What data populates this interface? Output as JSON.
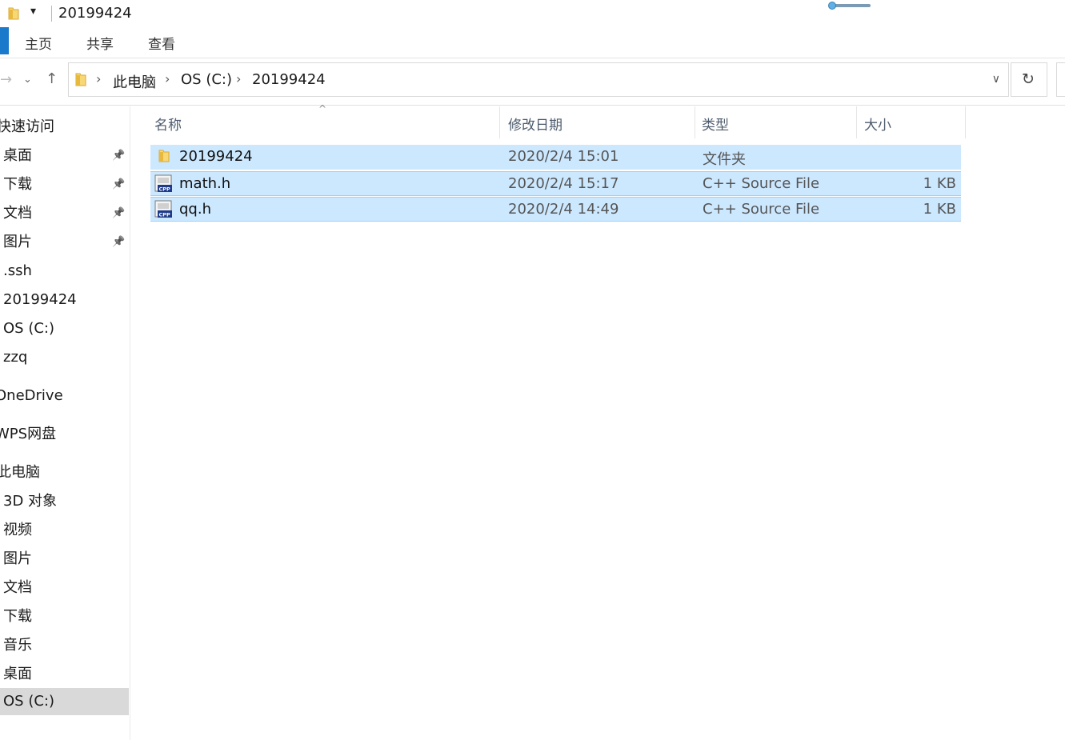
{
  "window": {
    "title": "20199424",
    "quick_access_dropdown": "▾"
  },
  "ribbon": {
    "tabs": [
      "主页",
      "共享",
      "查看"
    ]
  },
  "address": {
    "breadcrumbs": [
      "此电脑",
      "OS (C:)",
      "20199424"
    ]
  },
  "navpane": {
    "items": [
      {
        "label": "快速访问",
        "pinned": false
      },
      {
        "label": "桌面",
        "pinned": true
      },
      {
        "label": "下载",
        "pinned": true
      },
      {
        "label": "文档",
        "pinned": true
      },
      {
        "label": "图片",
        "pinned": true
      },
      {
        "label": ".ssh",
        "pinned": false
      },
      {
        "label": "20199424",
        "pinned": false
      },
      {
        "label": "OS (C:)",
        "pinned": false
      },
      {
        "label": "zzq",
        "pinned": false
      },
      {
        "label": "OneDrive",
        "pinned": false
      },
      {
        "label": "WPS网盘",
        "pinned": false
      },
      {
        "label": "此电脑",
        "pinned": false
      },
      {
        "label": "3D 对象",
        "pinned": false
      },
      {
        "label": "视频",
        "pinned": false
      },
      {
        "label": "图片",
        "pinned": false
      },
      {
        "label": "文档",
        "pinned": false
      },
      {
        "label": "下载",
        "pinned": false
      },
      {
        "label": "音乐",
        "pinned": false
      },
      {
        "label": "桌面",
        "pinned": false
      },
      {
        "label": "OS (C:)",
        "pinned": false,
        "selected": true
      }
    ]
  },
  "columns": {
    "name": "名称",
    "date": "修改日期",
    "type": "类型",
    "size": "大小"
  },
  "files": [
    {
      "name": "20199424",
      "date": "2020/2/4 15:01",
      "type": "文件夹",
      "size": "",
      "icon": "folder-icon"
    },
    {
      "name": "math.h",
      "date": "2020/2/4 15:17",
      "type": "C++ Source File",
      "size": "1 KB",
      "icon": "cpp-file-icon"
    },
    {
      "name": "qq.h",
      "date": "2020/2/4 14:49",
      "type": "C++ Source File",
      "size": "1 KB",
      "icon": "cpp-file-icon"
    }
  ],
  "colors": {
    "selection": "#cce8ff",
    "selection_border": "#99d1ff",
    "file_tab": "#1979ca",
    "folder": "#f8d775"
  }
}
